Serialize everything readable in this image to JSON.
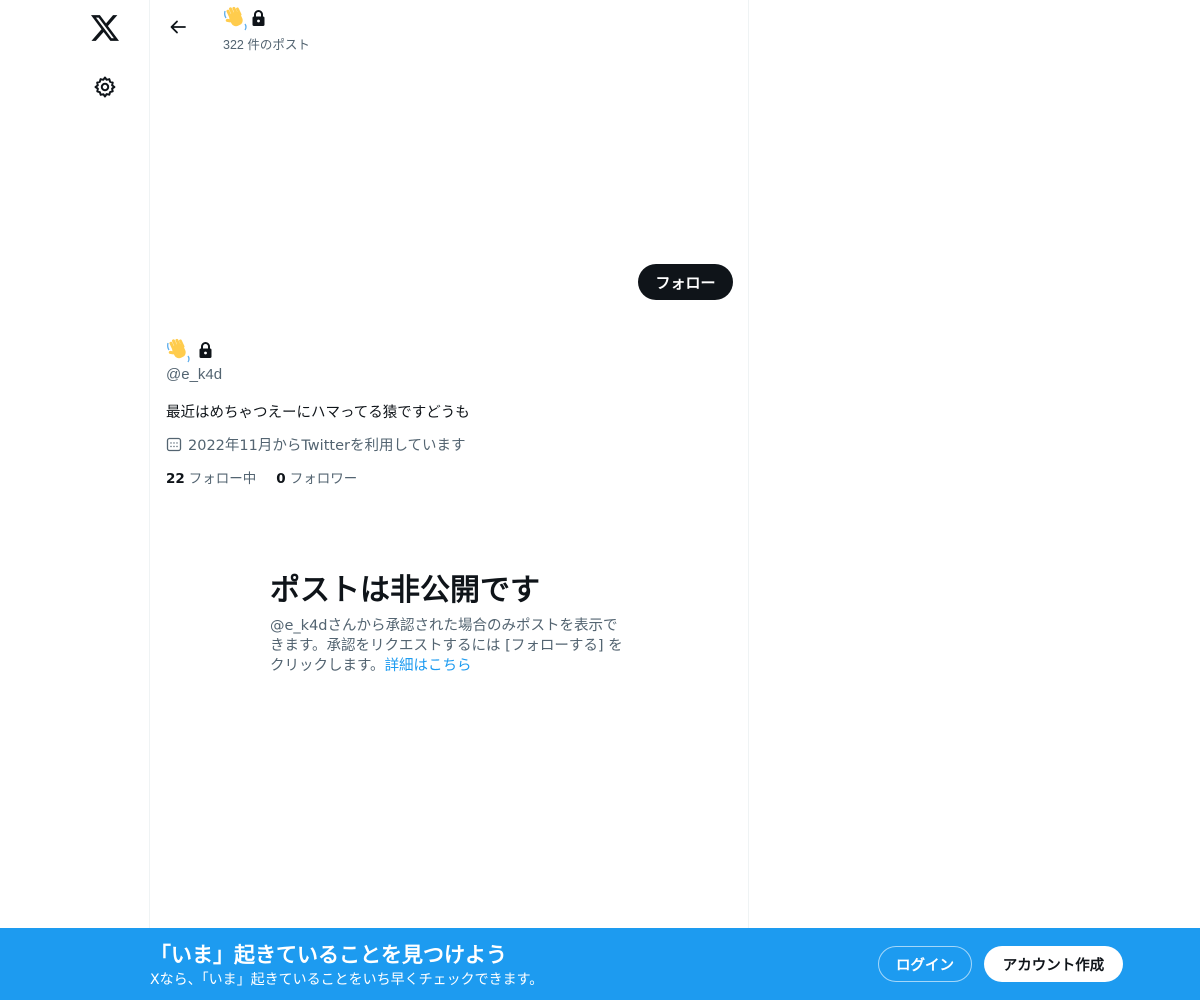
{
  "nav": {
    "logo_icon": "x-logo-icon",
    "settings_icon": "gear-icon"
  },
  "header": {
    "back_icon": "arrow-left-icon",
    "name_emoji": "waving-hand-emoji",
    "lock_icon": "lock-icon",
    "post_count": "322 件のポスト"
  },
  "profile": {
    "follow_label": "フォロー",
    "handle": "@e_k4d",
    "bio": "最近はめちゃつえーにハマってる猿ですどうも",
    "joined": "2022年11月からTwitterを利用しています",
    "following_count": "22",
    "following_label": "フォロー中",
    "followers_count": "0",
    "followers_label": "フォロワー"
  },
  "private_notice": {
    "title": "ポストは非公開です",
    "body": "@e_k4dさんから承認された場合のみポストを表示できます。承認をリクエストするには [フォローする] をクリックします。",
    "link": "詳細はこちら"
  },
  "bottom_bar": {
    "title": "「いま」起きていることを見つけよう",
    "subtitle": "Xなら、「いま」起きていることをいち早くチェックできます。",
    "login_label": "ログイン",
    "signup_label": "アカウント作成"
  },
  "colors": {
    "accent": "#1d9bf0",
    "text_primary": "#0f1419",
    "text_secondary": "#536471",
    "border": "#eff3f4"
  }
}
